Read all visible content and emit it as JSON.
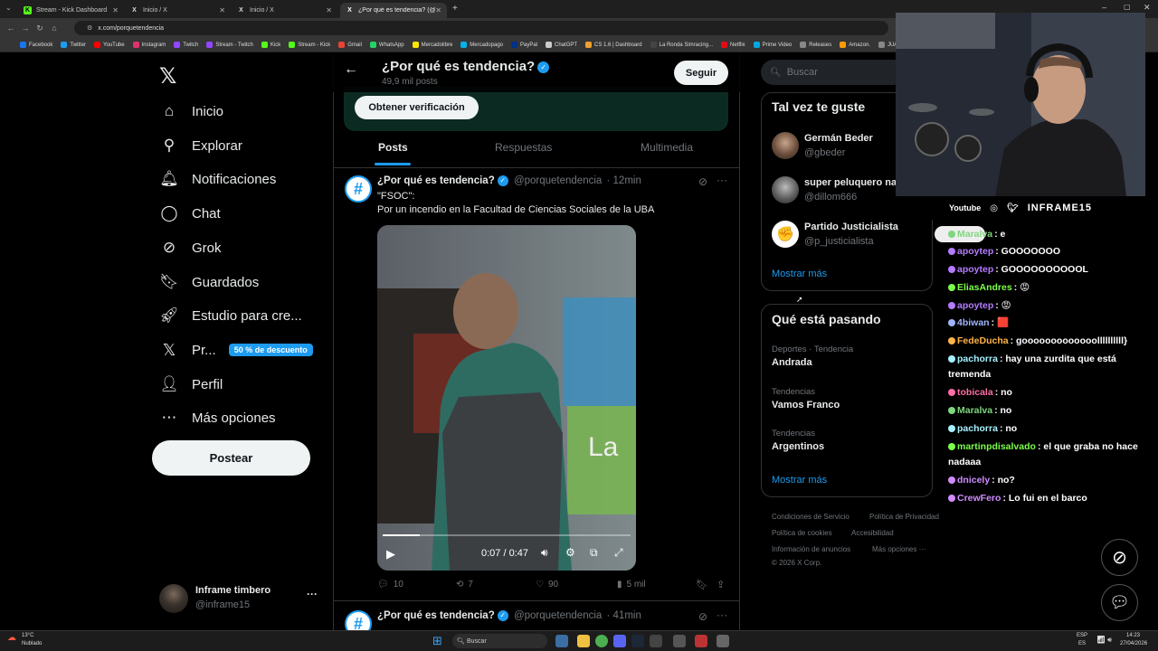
{
  "browser": {
    "tabs": [
      {
        "title": "Stream - Kick Dashboard",
        "fav": "K"
      },
      {
        "title": "Inicio / X",
        "fav": "X"
      },
      {
        "title": "Inicio / X",
        "fav": "X"
      },
      {
        "title": "¿Por qué es tendencia? (@porq...",
        "fav": "X"
      }
    ],
    "url": "x.com/porquetendencia",
    "bookmarks": [
      {
        "label": "Facebook",
        "color": "#1877f2"
      },
      {
        "label": "Twitter",
        "color": "#1d9bf0"
      },
      {
        "label": "YouTube",
        "color": "#ff0000"
      },
      {
        "label": "Instagram",
        "color": "#e1306c"
      },
      {
        "label": "Twitch",
        "color": "#9146ff"
      },
      {
        "label": "Stream - Twitch",
        "color": "#9146ff"
      },
      {
        "label": "Kick",
        "color": "#53fc18"
      },
      {
        "label": "Stream - Kick",
        "color": "#53fc18"
      },
      {
        "label": "Gmail",
        "color": "#ea4335"
      },
      {
        "label": "WhatsApp",
        "color": "#25d366"
      },
      {
        "label": "Mercadolibre",
        "color": "#ffe600"
      },
      {
        "label": "Mercadopago",
        "color": "#00b1ea"
      },
      {
        "label": "PayPal",
        "color": "#003087"
      },
      {
        "label": "ChatGPT",
        "color": "#cccccc"
      },
      {
        "label": "CS 1.6 | Dashboard",
        "color": "#f0a030"
      },
      {
        "label": "La Ronda Simracing...",
        "color": "#444444"
      },
      {
        "label": "Netflix",
        "color": "#e50914"
      },
      {
        "label": "Prime Video",
        "color": "#00a8e1"
      },
      {
        "label": "Releases",
        "color": "#888888"
      },
      {
        "label": "Amazon.",
        "color": "#ff9900"
      },
      {
        "label": "JUAN",
        "color": "#888888"
      }
    ]
  },
  "nav": {
    "items": [
      {
        "label": "Inicio",
        "icon": "home-icon"
      },
      {
        "label": "Explorar",
        "icon": "search-icon"
      },
      {
        "label": "Notificaciones",
        "icon": "bell-icon"
      },
      {
        "label": "Chat",
        "icon": "chat-icon"
      },
      {
        "label": "Grok",
        "icon": "grok-icon"
      },
      {
        "label": "Guardados",
        "icon": "bookmark-icon"
      },
      {
        "label": "Estudio para cre...",
        "icon": "rocket-icon"
      },
      {
        "label": "Pr...",
        "icon": "x-logo-icon"
      },
      {
        "label": "Perfil",
        "icon": "user-icon"
      },
      {
        "label": "Más opciones",
        "icon": "more-circle-icon"
      }
    ],
    "premium_badge": "50 % de descuento",
    "post_button": "Postear",
    "account": {
      "name": "Inframe timbero",
      "handle": "@inframe15",
      "more": "···"
    }
  },
  "header": {
    "title": "¿Por qué es tendencia?",
    "posts_count": "49,9 mil posts",
    "follow_label": "Seguir",
    "verify_label": "Obtener verificación"
  },
  "tabs": [
    "Posts",
    "Respuestas",
    "Multimedia"
  ],
  "tweets": [
    {
      "name": "¿Por qué es tendencia?",
      "handle": "@porquetendencia",
      "time": "· 12min",
      "line1": "\"FSOC\":",
      "line2": "Por un incendio en la Facultad de Ciencias Sociales de la UBA",
      "video": {
        "time": "0:07 / 0:47",
        "progress": 0.149
      },
      "actions": {
        "replies": "10",
        "reposts": "7",
        "likes": "90",
        "views": "5 mil"
      }
    },
    {
      "name": "¿Por qué es tendencia?",
      "handle": "@porquetendencia",
      "time": "· 41min"
    }
  ],
  "right": {
    "search_placeholder": "Buscar",
    "suggest_title": "Tal vez te guste",
    "suggestions": [
      {
        "name": "Germán Beder",
        "handle": "@gbeder"
      },
      {
        "name": "super peluquero na",
        "handle": "@dillom666"
      },
      {
        "name": "Partido Justicialista",
        "handle": "@p_justicialista"
      }
    ],
    "show_more": "Mostrar más",
    "trends_title": "Qué está pasando",
    "trends": [
      {
        "category": "Deportes · Tendencia",
        "title": "Andrada"
      },
      {
        "category": "Tendencias",
        "title": "Vamos Franco"
      },
      {
        "category": "Tendencias",
        "title": "Argentinos"
      }
    ],
    "footer": [
      "Condiciones de Servicio",
      "Política de Privacidad",
      "Política de cookies",
      "Accesibilidad",
      "Información de anuncios",
      "Más opciones ···",
      "© 2026 X Corp."
    ]
  },
  "stream": {
    "channel": "INFRAME15",
    "platform": "Youtube",
    "chat": [
      {
        "user": "Maralva",
        "color": "#7fd67f",
        "msg": ": e"
      },
      {
        "user": "apoytep",
        "color": "#b57bff",
        "msg": ": GOOOOOOO"
      },
      {
        "user": "apoytep",
        "color": "#b57bff",
        "msg": ": GOOOOOOOOOOL"
      },
      {
        "user": "EliasAndres",
        "color": "#7cff4a",
        "msg": ": 😡"
      },
      {
        "user": "apoytep",
        "color": "#b57bff",
        "msg": ": 😡"
      },
      {
        "user": "4biwan",
        "color": "#9fb4ff",
        "msg": ": 🟥"
      },
      {
        "user": "FedeDucha",
        "color": "#ffb347",
        "msg": ": gooooooooooooollllllllll}"
      },
      {
        "user": "pachorra",
        "color": "#a7f0ff",
        "msg": ": hay una zurdita que está tremenda"
      },
      {
        "user": "tobicala",
        "color": "#ff6fa5",
        "msg": ": no"
      },
      {
        "user": "Maralva",
        "color": "#7fd67f",
        "msg": ": no"
      },
      {
        "user": "pachorra",
        "color": "#a7f0ff",
        "msg": ": no"
      },
      {
        "user": "martinpdisalvado",
        "color": "#7cff4a",
        "msg": ": el que graba no hace nadaaa"
      },
      {
        "user": "dnicely",
        "color": "#d18cff",
        "msg": ": no?"
      },
      {
        "user": "CrewFero",
        "color": "#d18cff",
        "msg": ": Lo fui en el barco"
      }
    ]
  },
  "taskbar": {
    "weather_temp": "13°C",
    "weather_desc": "Nublado",
    "search": "Buscar",
    "lang1": "ESP",
    "lang2": "ES",
    "time": "14:23",
    "date": "27/04/2026"
  }
}
